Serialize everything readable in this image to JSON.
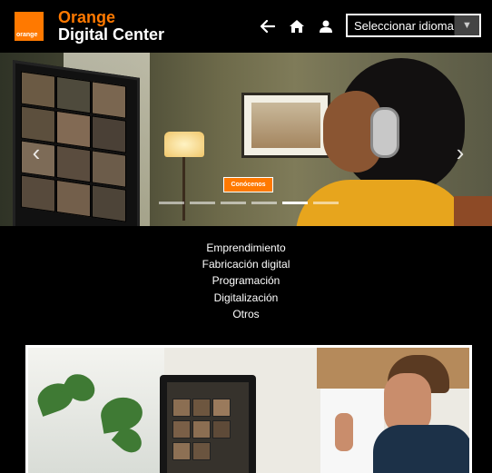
{
  "header": {
    "logo_text": "orange",
    "brand_line1": "Orange",
    "brand_line2": "Digital Center",
    "icons": [
      "back-arrow-icon",
      "home-icon",
      "user-icon"
    ],
    "language_select": {
      "value": "Seleccionar idioma"
    },
    "colors": {
      "brand": "#ff7900",
      "background": "#000000"
    }
  },
  "hero": {
    "cta_label": "Conócenos",
    "slides_count": 6,
    "active_slide_index": 4
  },
  "menu": {
    "items": [
      "Emprendimiento",
      "Fabricación digital",
      "Programación",
      "Digitalización",
      "Otros"
    ]
  }
}
